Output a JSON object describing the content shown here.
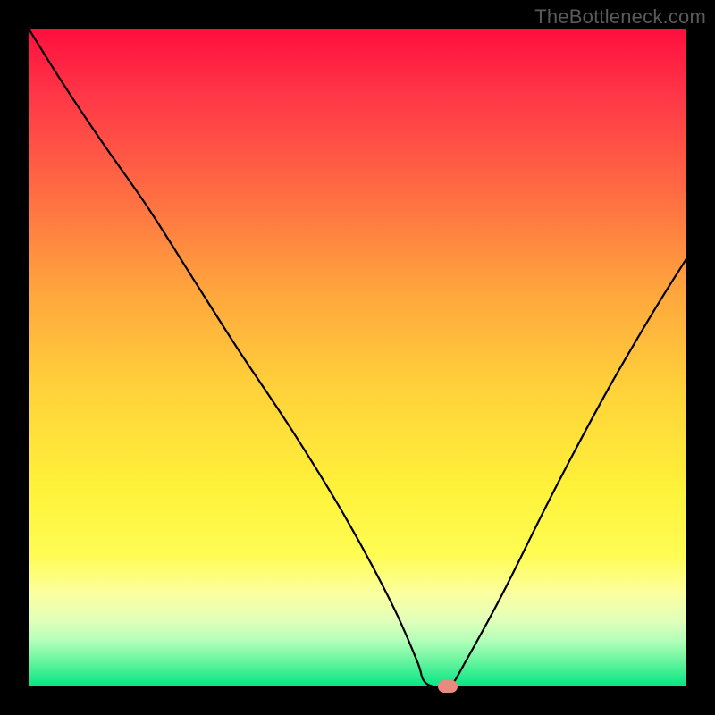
{
  "watermark": "TheBottleneck.com",
  "chart_data": {
    "type": "line",
    "title": "",
    "xlabel": "",
    "ylabel": "",
    "xlim": [
      0,
      100
    ],
    "ylim": [
      0,
      100
    ],
    "grid": false,
    "series": [
      {
        "name": "bottleneck-curve",
        "x": [
          0,
          5,
          11,
          18,
          25,
          32,
          40,
          48,
          55,
          59,
          60,
          61.5,
          63.5,
          64.5,
          66,
          72,
          80,
          88,
          95,
          100
        ],
        "values": [
          100,
          92,
          83,
          73,
          62,
          51,
          39,
          26,
          13,
          4,
          1,
          0,
          0,
          0.5,
          3,
          14,
          30,
          45,
          57,
          65
        ]
      }
    ],
    "marker": {
      "x": 63.7,
      "y": 0
    },
    "gradient_stops": [
      {
        "pos": 0,
        "color": "#ff0e3e"
      },
      {
        "pos": 10,
        "color": "#ff3647"
      },
      {
        "pos": 25,
        "color": "#ff6c43"
      },
      {
        "pos": 40,
        "color": "#ffa63d"
      },
      {
        "pos": 55,
        "color": "#ffd23a"
      },
      {
        "pos": 70,
        "color": "#fff23a"
      },
      {
        "pos": 80,
        "color": "#fffc53"
      },
      {
        "pos": 86,
        "color": "#fbffa1"
      },
      {
        "pos": 90,
        "color": "#e1ffba"
      },
      {
        "pos": 93,
        "color": "#b3ffba"
      },
      {
        "pos": 96,
        "color": "#6cf5a0"
      },
      {
        "pos": 100,
        "color": "#02e682"
      }
    ]
  }
}
